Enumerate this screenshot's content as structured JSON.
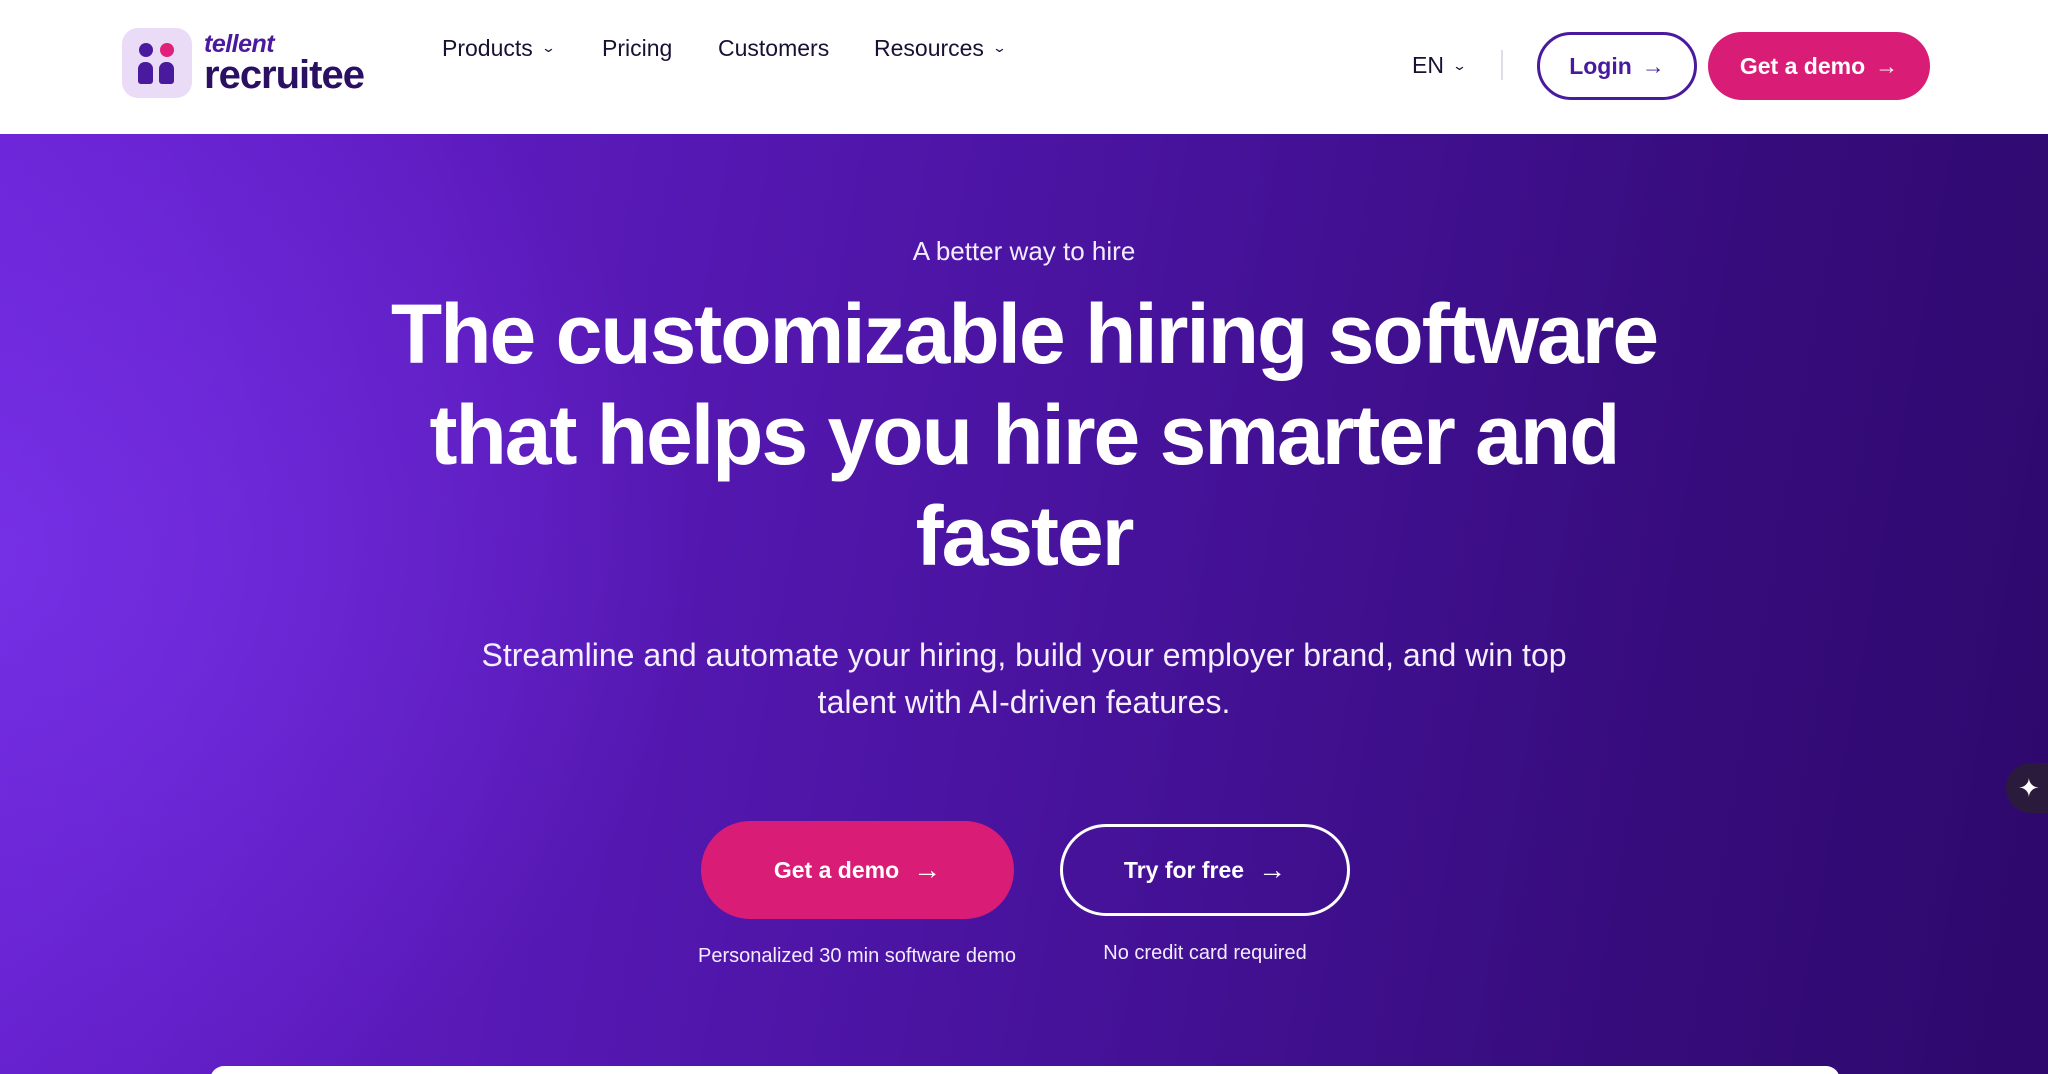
{
  "brand": {
    "logo_small": "tellent",
    "logo_big": "recruitee",
    "accent_color": "#d91c76",
    "primary_color": "#4a1a9e"
  },
  "nav": {
    "items": [
      {
        "label": "Products",
        "has_dropdown": true
      },
      {
        "label": "Pricing",
        "has_dropdown": false
      },
      {
        "label": "Customers",
        "has_dropdown": false
      },
      {
        "label": "Resources",
        "has_dropdown": true
      }
    ],
    "language": "EN",
    "login_label": "Login",
    "demo_label": "Get a demo"
  },
  "hero": {
    "eyebrow": "A better way to hire",
    "headline": "The customizable hiring software that helps you hire smarter and faster",
    "subheadline": "Streamline and automate your hiring, build your employer brand, and win top talent with AI-driven features.",
    "primary_cta": "Get a demo",
    "primary_note": "Personalized 30 min software demo",
    "secondary_cta": "Try for free",
    "secondary_note": "No credit card required"
  },
  "icons": {
    "chevron": "chevron-down-icon",
    "arrow": "arrow-right-icon",
    "sparkle": "sparkle-icon"
  }
}
